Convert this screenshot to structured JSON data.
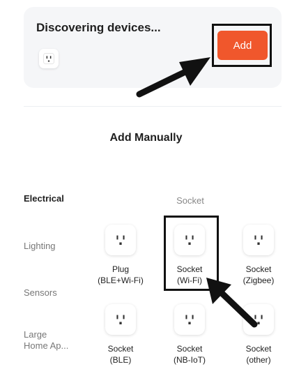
{
  "discovery": {
    "title": "Discovering devices...",
    "add_label": "Add"
  },
  "section_title": "Add Manually",
  "categories": [
    {
      "label": "Electrical",
      "active": true
    },
    {
      "label": "Lighting",
      "active": false
    },
    {
      "label": "Sensors",
      "active": false
    },
    {
      "label": "Large\nHome Ap...",
      "active": false
    }
  ],
  "subcategory_title": "Socket",
  "devices": [
    {
      "line1": "Plug",
      "line2": "(BLE+Wi-Fi)"
    },
    {
      "line1": "Socket",
      "line2": "(Wi-Fi)"
    },
    {
      "line1": "Socket",
      "line2": "(Zigbee)"
    },
    {
      "line1": "Socket",
      "line2": "(BLE)"
    },
    {
      "line1": "Socket",
      "line2": "(NB-IoT)"
    },
    {
      "line1": "Socket",
      "line2": "(other)"
    }
  ],
  "icons": {
    "device": "socket-icon",
    "annotation": "arrow-icon"
  },
  "colors": {
    "accent": "#f0572c",
    "card_bg": "#f5f6f8",
    "annotation": "#111111"
  }
}
